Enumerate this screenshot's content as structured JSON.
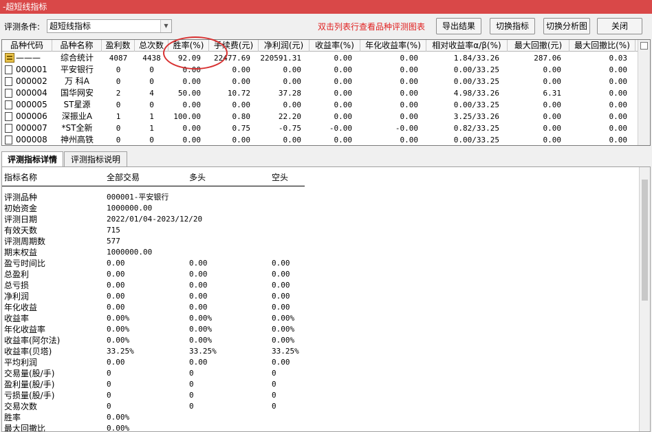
{
  "window": {
    "title": "-超短线指标"
  },
  "toolbar": {
    "condition_label": "评测条件:",
    "condition_value": "超短线指标",
    "hint": "双击列表行查看品种评测图表",
    "export_label": "导出结果",
    "switch_indicator_label": "切换指标",
    "switch_chart_label": "切换分析图",
    "close_label": "关闭"
  },
  "grid": {
    "columns": [
      "品种代码",
      "品种名称",
      "盈利数",
      "总次数",
      "胜率(%)",
      "手续费(元)",
      "净利润(元)",
      "收益率(%)",
      "年化收益率(%)",
      "相对收益率α/β(%)",
      "最大回撤(元)",
      "最大回撤比(%)"
    ],
    "rows": [
      [
        "———",
        "综合统计",
        "4087",
        "4438",
        "92.09",
        "22477.69",
        "220591.31",
        "0.00",
        "0.00",
        "1.84/33.26",
        "287.06",
        "0.03"
      ],
      [
        "000001",
        "平安银行",
        "0",
        "0",
        "0.00",
        "0.00",
        "0.00",
        "0.00",
        "0.00",
        "0.00/33.25",
        "0.00",
        "0.00"
      ],
      [
        "000002",
        "万 科A",
        "0",
        "0",
        "0.00",
        "0.00",
        "0.00",
        "0.00",
        "0.00",
        "0.00/33.25",
        "0.00",
        "0.00"
      ],
      [
        "000004",
        "国华网安",
        "2",
        "4",
        "50.00",
        "10.72",
        "37.28",
        "0.00",
        "0.00",
        "4.98/33.26",
        "6.31",
        "0.00"
      ],
      [
        "000005",
        "ST星源",
        "0",
        "0",
        "0.00",
        "0.00",
        "0.00",
        "0.00",
        "0.00",
        "0.00/33.25",
        "0.00",
        "0.00"
      ],
      [
        "000006",
        "深振业A",
        "1",
        "1",
        "100.00",
        "0.80",
        "22.20",
        "0.00",
        "0.00",
        "3.25/33.26",
        "0.00",
        "0.00"
      ],
      [
        "000007",
        "*ST全新",
        "0",
        "1",
        "0.00",
        "0.75",
        "-0.75",
        "-0.00",
        "-0.00",
        "0.82/33.25",
        "0.00",
        "0.00"
      ],
      [
        "000008",
        "神州高铁",
        "0",
        "0",
        "0.00",
        "0.00",
        "0.00",
        "0.00",
        "0.00",
        "0.00/33.25",
        "0.00",
        "0.00"
      ]
    ]
  },
  "tabs": [
    "评测指标详情",
    "评测指标说明"
  ],
  "details": {
    "headers": [
      "指标名称",
      "全部交易",
      "多头",
      "空头"
    ],
    "rows": [
      [
        "评测品种",
        "000001-平安银行",
        "",
        ""
      ],
      [
        "初始资金",
        "1000000.00",
        "",
        ""
      ],
      [
        "评测日期",
        "2022/01/04-2023/12/20",
        "",
        ""
      ],
      [
        "有效天数",
        "715",
        "",
        ""
      ],
      [
        "评测周期数",
        "577",
        "",
        ""
      ],
      [
        "期末权益",
        "1000000.00",
        "",
        ""
      ],
      [
        "盈亏时间比",
        "0.00",
        "0.00",
        "0.00"
      ],
      [
        "总盈利",
        "0.00",
        "0.00",
        "0.00"
      ],
      [
        "总亏损",
        "0.00",
        "0.00",
        "0.00"
      ],
      [
        "净利润",
        "0.00",
        "0.00",
        "0.00"
      ],
      [
        "年化收益",
        "0.00",
        "0.00",
        "0.00"
      ],
      [
        "收益率",
        "0.00%",
        "0.00%",
        "0.00%"
      ],
      [
        "年化收益率",
        "0.00%",
        "0.00%",
        "0.00%"
      ],
      [
        "收益率(阿尔法)",
        "0.00%",
        "0.00%",
        "0.00%"
      ],
      [
        "收益率(贝塔)",
        "33.25%",
        "33.25%",
        "33.25%"
      ],
      [
        "平均利润",
        "0.00",
        "0.00",
        "0.00"
      ],
      [
        "交易量(股/手)",
        "0",
        "0",
        "0"
      ],
      [
        "盈利量(股/手)",
        "0",
        "0",
        "0"
      ],
      [
        "亏损量(股/手)",
        "0",
        "0",
        "0"
      ],
      [
        "交易次数",
        "0",
        "0",
        "0"
      ],
      [
        "胜率",
        "0.00%",
        "",
        ""
      ],
      [
        "最大回撤比",
        "0.00%",
        "",
        ""
      ]
    ]
  },
  "colors": {
    "titlebar": "#d94848",
    "hint": "#e02020",
    "highlight_circle": "#d83030"
  }
}
